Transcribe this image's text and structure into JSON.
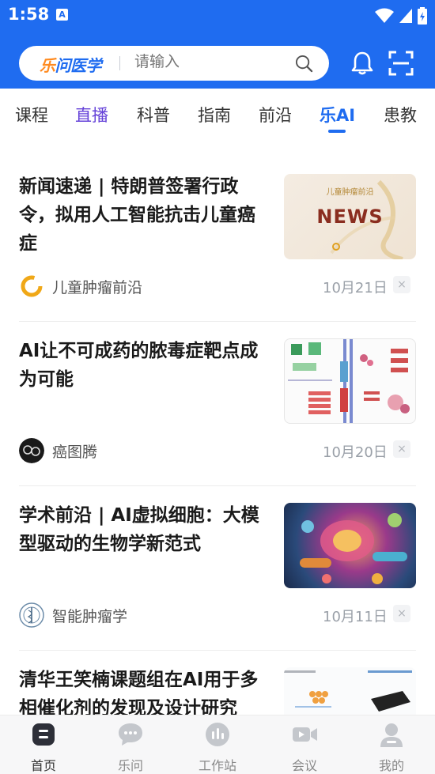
{
  "status_bar": {
    "time": "1:58",
    "notification_icon": "A"
  },
  "header": {
    "brand_first": "乐",
    "brand_rest": "问医学",
    "search_placeholder": "请输入"
  },
  "tabs": [
    {
      "label": "课程"
    },
    {
      "label": "直播"
    },
    {
      "label": "科普"
    },
    {
      "label": "指南"
    },
    {
      "label": "前沿"
    },
    {
      "label": "乐AI"
    },
    {
      "label": "患教"
    }
  ],
  "articles": [
    {
      "title": "新闻速递 | 特朗普签署行政令，拟用人工智能抗击儿童癌症",
      "source": "儿童肿瘤前沿",
      "date": "10月21日",
      "thumb_caption": "儿童肿瘤前沿",
      "thumb_word": "NEWS"
    },
    {
      "title": "AI让不可成药的脓毒症靶点成为可能",
      "source": "癌图腾",
      "date": "10月20日"
    },
    {
      "title": "学术前沿 | AI虚拟细胞：大模型驱动的生物学新范式",
      "source": "智能肿瘤学",
      "date": "10月11日"
    },
    {
      "title": "清华王笑楠课题组在AI用于多相催化剂的发现及设计研究",
      "source": "",
      "date": ""
    }
  ],
  "close_symbol": "×",
  "bottom_nav": [
    {
      "label": "首页",
      "icon": "home-icon"
    },
    {
      "label": "乐问",
      "icon": "chat-icon"
    },
    {
      "label": "工作站",
      "icon": "workstation-icon"
    },
    {
      "label": "会议",
      "icon": "video-icon"
    },
    {
      "label": "我的",
      "icon": "profile-icon"
    }
  ],
  "colors": {
    "primary": "#1f6cf0",
    "live": "#6340d8",
    "brand_accent": "#ff8a1f"
  }
}
